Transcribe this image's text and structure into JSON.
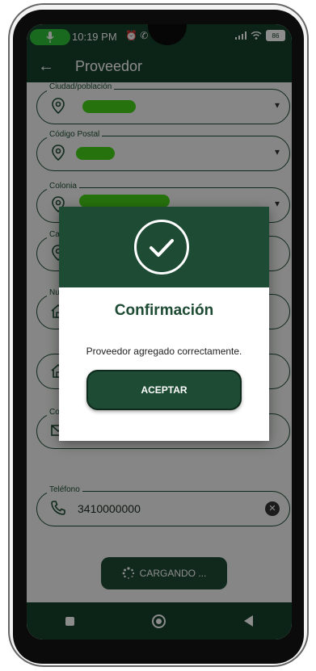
{
  "status_bar": {
    "time": "10:19 PM",
    "icons": "⏰ ✆ ●",
    "battery": "86"
  },
  "app_bar": {
    "title": "Proveedor"
  },
  "form": {
    "fields": [
      {
        "label": "Ciudad/población"
      },
      {
        "label": "Código Postal"
      },
      {
        "label": "Colonia"
      },
      {
        "label": "Ca"
      },
      {
        "label": "Nu"
      },
      {
        "label": ""
      },
      {
        "label": "Co"
      },
      {
        "label": "Teléfono",
        "value": "3410000000"
      }
    ],
    "loading_label": "CARGANDO ..."
  },
  "dialog": {
    "title": "Confirmación",
    "message": "Proveedor agregado correctamente.",
    "accept_label": "ACEPTAR"
  },
  "colors": {
    "primary": "#1e4b33",
    "status_bar": "#16402b",
    "redaction": "#45d018"
  }
}
